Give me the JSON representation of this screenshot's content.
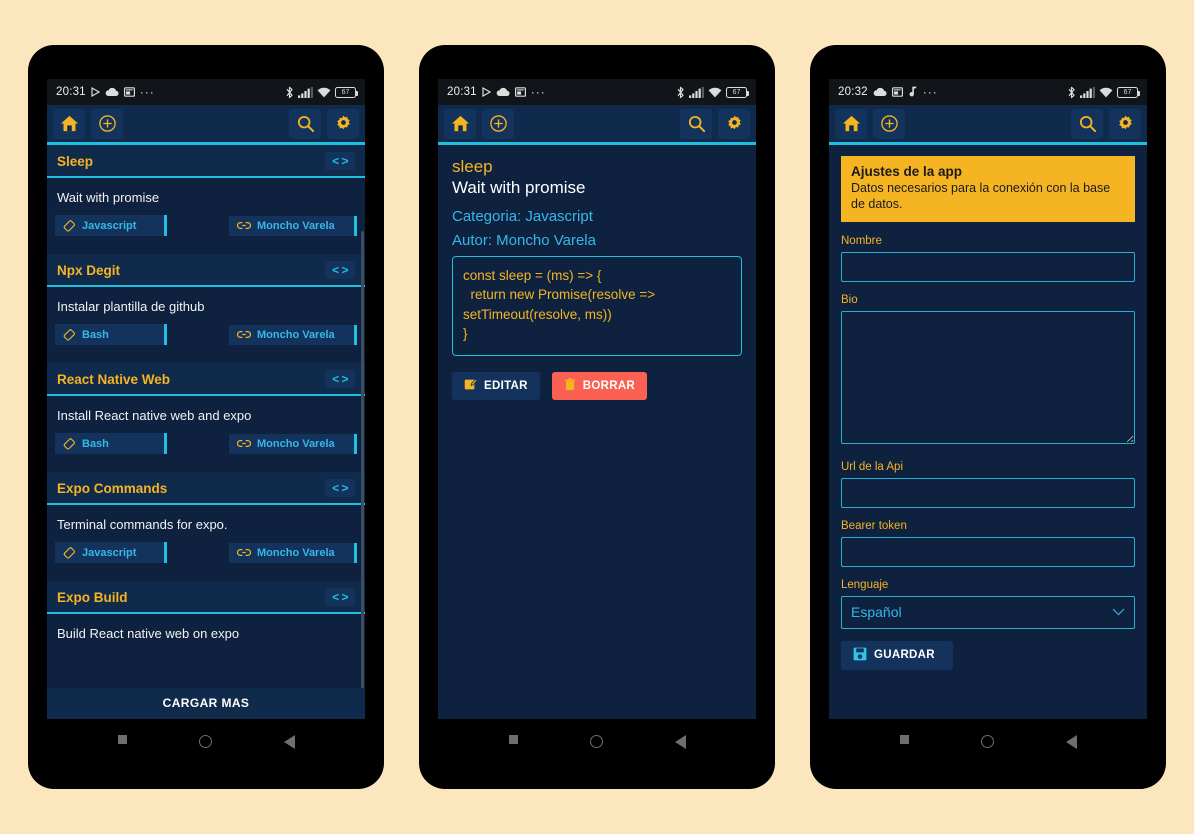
{
  "theme": {
    "page_background": "#fce6bd",
    "screen_background": "#0e2240",
    "panel_background": "#102a4c",
    "accent_amber": "#f5b422",
    "accent_cyan": "#1fbfe0",
    "text_cyan": "#36b7e8",
    "danger_red": "#fb6152"
  },
  "phones": [
    {
      "status_bar": {
        "time": "20:31",
        "left_icons": [
          "play-triangle-icon",
          "cloud-icon",
          "media-card-icon",
          "more-dots-icon"
        ],
        "right_icons": [
          "bluetooth-icon",
          "cellular-signal-icon",
          "wifi-icon"
        ],
        "battery_level": "67"
      },
      "app_bar": {
        "home_label": "home-icon",
        "add_label": "add-circle-icon",
        "search_label": "search-icon",
        "settings_label": "gear-icon"
      },
      "list": {
        "code_button_label": "< >",
        "load_more_label": "CARGAR MAS",
        "cards": [
          {
            "title": "Sleep",
            "description": "Wait with promise",
            "language": "Javascript",
            "author": "Moncho Varela"
          },
          {
            "title": "Npx Degit",
            "description": "Instalar plantilla de github",
            "language": "Bash",
            "author": "Moncho Varela"
          },
          {
            "title": "React Native Web",
            "description": "Install React native web and expo",
            "language": "Bash",
            "author": "Moncho Varela"
          },
          {
            "title": "Expo Commands",
            "description": "Terminal commands for expo.",
            "language": "Javascript",
            "author": "Moncho Varela"
          },
          {
            "title": "Expo Build",
            "description": "Build  React native web on expo",
            "language": "",
            "author": ""
          }
        ]
      }
    },
    {
      "status_bar": {
        "time": "20:31",
        "left_icons": [
          "play-triangle-icon",
          "cloud-icon",
          "media-card-icon",
          "more-dots-icon"
        ],
        "right_icons": [
          "bluetooth-icon",
          "cellular-signal-icon",
          "wifi-icon"
        ],
        "battery_level": "67"
      },
      "app_bar": {
        "home_label": "home-icon",
        "add_label": "add-circle-icon",
        "search_label": "search-icon",
        "settings_label": "gear-icon"
      },
      "detail": {
        "title": "sleep",
        "subtitle": "Wait with promise",
        "category": "Categoria: Javascript",
        "author": "Autor: Moncho Varela",
        "code": "const sleep = (ms) => {\n  return new Promise(resolve =>\nsetTimeout(resolve, ms))\n}",
        "edit_label": "EDITAR",
        "delete_label": "BORRAR"
      }
    },
    {
      "status_bar": {
        "time": "20:32",
        "left_icons": [
          "cloud-icon",
          "media-card-icon",
          "music-note-icon",
          "more-dots-icon"
        ],
        "right_icons": [
          "bluetooth-icon",
          "cellular-signal-icon",
          "wifi-icon"
        ],
        "battery_level": "67"
      },
      "app_bar": {
        "home_label": "home-icon",
        "add_label": "add-circle-icon",
        "search_label": "search-icon",
        "settings_label": "gear-icon"
      },
      "settings": {
        "notice_title": "Ajustes de la app",
        "notice_text": "Datos necesarios para la conexión con la base de datos.",
        "fields": [
          {
            "label": "Nombre",
            "value": "",
            "type": "input"
          },
          {
            "label": "Bio",
            "value": "",
            "type": "textarea"
          },
          {
            "label": "Url de la Api",
            "value": "",
            "type": "input"
          },
          {
            "label": "Bearer token",
            "value": "",
            "type": "input"
          },
          {
            "label": "Lenguaje",
            "value": "Español",
            "type": "select"
          }
        ],
        "save_label": "GUARDAR"
      }
    }
  ],
  "nav_bar": {
    "recents": "square-recents-icon",
    "home": "circle-home-icon",
    "back": "triangle-back-icon"
  }
}
